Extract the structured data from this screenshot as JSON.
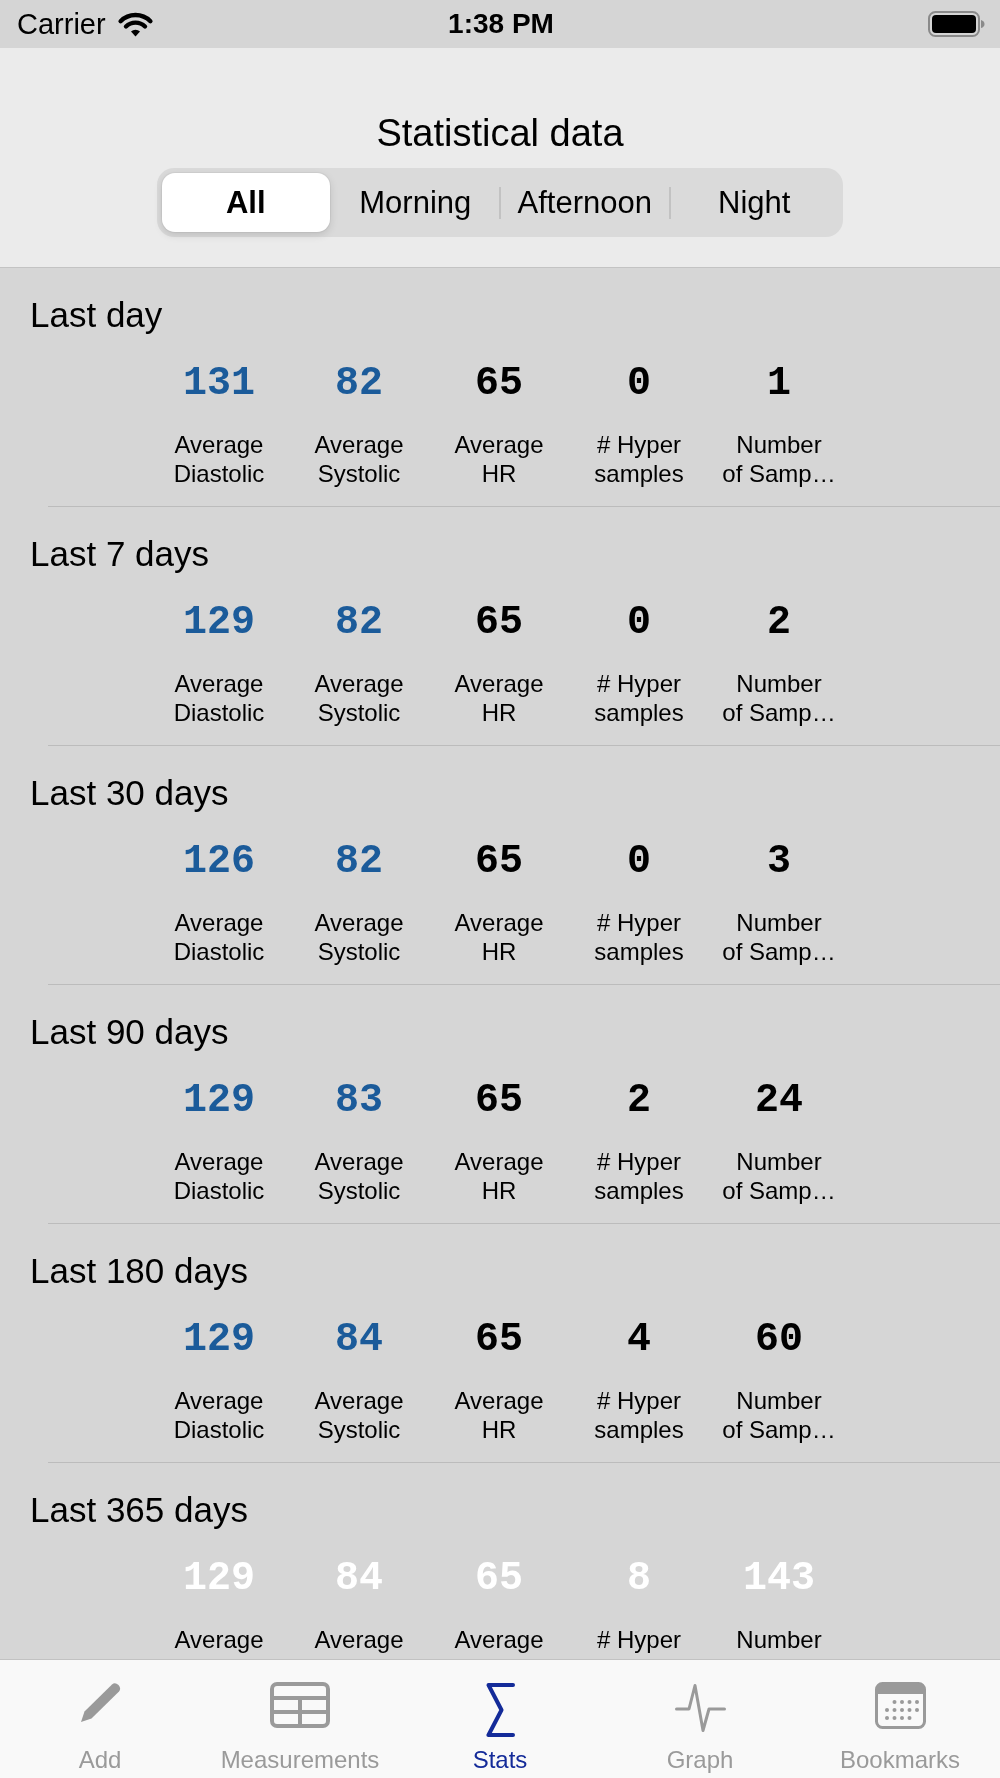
{
  "status_bar": {
    "carrier": "Carrier",
    "time": "1:38 PM"
  },
  "header": {
    "title": "Statistical data",
    "segments": [
      {
        "label": "All",
        "selected": true
      },
      {
        "label": "Morning",
        "selected": false
      },
      {
        "label": "Afternoon",
        "selected": false
      },
      {
        "label": "Night",
        "selected": false
      }
    ]
  },
  "sections": [
    {
      "title": "Last day",
      "stats": [
        {
          "value": "131",
          "label": "Average\nDiastolic",
          "color": "#1b5b9a"
        },
        {
          "value": "82",
          "label": "Average\nSystolic",
          "color": "#1b5b9a"
        },
        {
          "value": "65",
          "label": "Average\nHR",
          "color": "#000000"
        },
        {
          "value": "0",
          "label": "# Hyper\nsamples",
          "color": "#000000"
        },
        {
          "value": "1",
          "label": "Number\nof Samp…",
          "color": "#000000"
        }
      ]
    },
    {
      "title": "Last 7 days",
      "stats": [
        {
          "value": "129",
          "label": "Average\nDiastolic",
          "color": "#1b5b9a"
        },
        {
          "value": "82",
          "label": "Average\nSystolic",
          "color": "#1b5b9a"
        },
        {
          "value": "65",
          "label": "Average\nHR",
          "color": "#000000"
        },
        {
          "value": "0",
          "label": "# Hyper\nsamples",
          "color": "#000000"
        },
        {
          "value": "2",
          "label": "Number\nof Samp…",
          "color": "#000000"
        }
      ]
    },
    {
      "title": "Last 30 days",
      "stats": [
        {
          "value": "126",
          "label": "Average\nDiastolic",
          "color": "#1b5b9a"
        },
        {
          "value": "82",
          "label": "Average\nSystolic",
          "color": "#1b5b9a"
        },
        {
          "value": "65",
          "label": "Average\nHR",
          "color": "#000000"
        },
        {
          "value": "0",
          "label": "# Hyper\nsamples",
          "color": "#000000"
        },
        {
          "value": "3",
          "label": "Number\nof Samp…",
          "color": "#000000"
        }
      ]
    },
    {
      "title": "Last 90 days",
      "stats": [
        {
          "value": "129",
          "label": "Average\nDiastolic",
          "color": "#1b5b9a"
        },
        {
          "value": "83",
          "label": "Average\nSystolic",
          "color": "#1b5b9a"
        },
        {
          "value": "65",
          "label": "Average\nHR",
          "color": "#000000"
        },
        {
          "value": "2",
          "label": "# Hyper\nsamples",
          "color": "#000000"
        },
        {
          "value": "24",
          "label": "Number\nof Samp…",
          "color": "#000000"
        }
      ]
    },
    {
      "title": "Last 180 days",
      "stats": [
        {
          "value": "129",
          "label": "Average\nDiastolic",
          "color": "#1b5b9a"
        },
        {
          "value": "84",
          "label": "Average\nSystolic",
          "color": "#1b5b9a"
        },
        {
          "value": "65",
          "label": "Average\nHR",
          "color": "#000000"
        },
        {
          "value": "4",
          "label": "# Hyper\nsamples",
          "color": "#000000"
        },
        {
          "value": "60",
          "label": "Number\nof Samp…",
          "color": "#000000"
        }
      ]
    },
    {
      "title": "Last 365 days",
      "stats": [
        {
          "value": "129",
          "label": "Average",
          "color": "#ffffff"
        },
        {
          "value": "84",
          "label": "Average",
          "color": "#ffffff"
        },
        {
          "value": "65",
          "label": "Average",
          "color": "#ffffff"
        },
        {
          "value": "8",
          "label": "# Hyper",
          "color": "#ffffff"
        },
        {
          "value": "143",
          "label": "Number",
          "color": "#ffffff"
        }
      ]
    }
  ],
  "tab_bar": {
    "tabs": [
      {
        "label": "Add",
        "selected": false
      },
      {
        "label": "Measurements",
        "selected": false
      },
      {
        "label": "Stats",
        "selected": true
      },
      {
        "label": "Graph",
        "selected": false
      },
      {
        "label": "Bookmarks",
        "selected": false
      }
    ]
  }
}
